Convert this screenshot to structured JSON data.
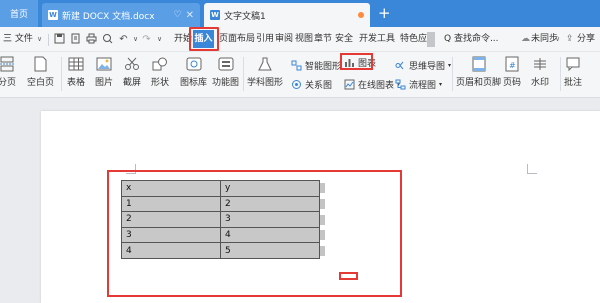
{
  "titlebar": {
    "home_tab": "首页",
    "doc1_tab": "新建 DOCX 文档.docx",
    "doc2_tab": "文字文稿1",
    "new_tab": "+"
  },
  "menubar": {
    "file_menu": "三 文件",
    "tabs": [
      "开始",
      "插入",
      "页面布局",
      "引用",
      "审阅",
      "视图",
      "章节",
      "安全",
      "开发工具",
      "特色应"
    ],
    "search": "Q 查找命令...",
    "sync": "未同步",
    "share": "分享"
  },
  "ribbon": {
    "page_label": "分页",
    "blank_page": "空白页",
    "table": "表格",
    "picture": "图片",
    "screenshot": "截屏",
    "shape": "形状",
    "icon_lib": "图标库",
    "func_chart": "功能图",
    "science_shape": "学科图形",
    "smart_shape": "智能图形",
    "chart": "图表",
    "mind_map": "思维导图",
    "relation": "关系图",
    "online_chart": "在线图表",
    "flowchart": "流程图",
    "header_footer": "页眉和页脚",
    "page_number": "页码",
    "watermark": "水印",
    "comment": "批注"
  },
  "colors": {
    "title_blue": "#3a87d9",
    "highlight_red": "#e53935",
    "table_fill": "#c8c8c8"
  },
  "table": {
    "rows": [
      [
        "x",
        "y"
      ],
      [
        "1",
        "2"
      ],
      [
        "2",
        "3"
      ],
      [
        "3",
        "4"
      ],
      [
        "4",
        "5"
      ]
    ]
  }
}
